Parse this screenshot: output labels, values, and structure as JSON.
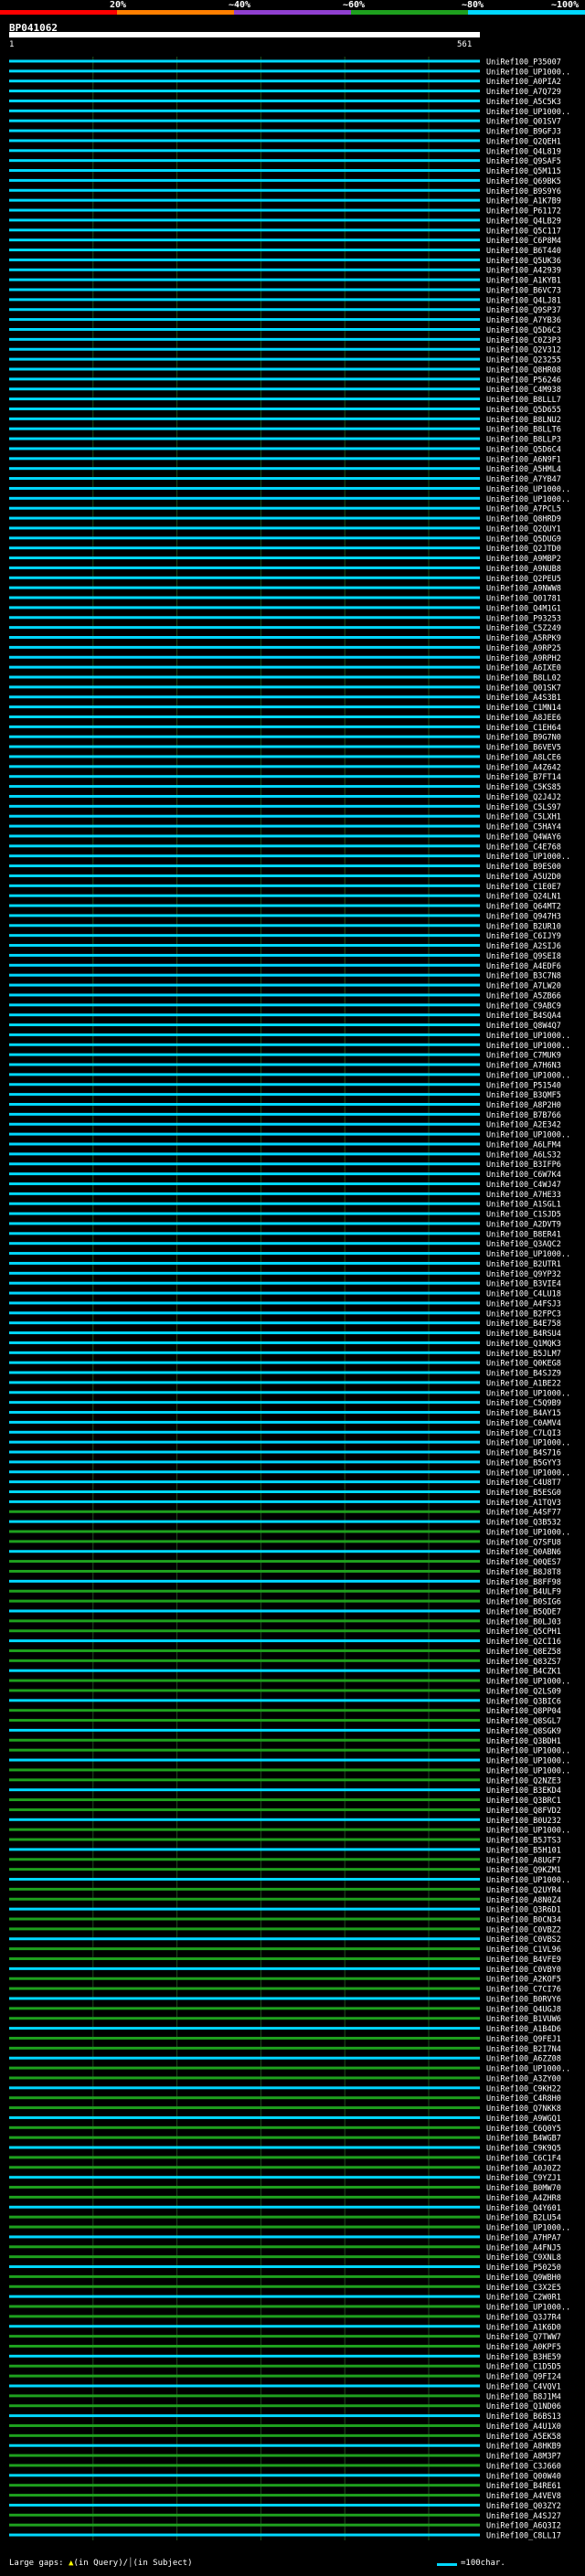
{
  "header": {
    "pct_labels": [
      "20%",
      "~40%",
      "~60%",
      "~80%",
      "~100%"
    ],
    "pct_colors": [
      "#ff0000",
      "#ff7f00",
      "#8f3fcf",
      "#1ea01e",
      "#00d8ff"
    ],
    "query_id": "BP041062",
    "ruler_start": "1",
    "ruler_end": "561"
  },
  "footer": {
    "gaps_label": "Large gaps: ",
    "in_query": "(in Query)/",
    "in_subject": "(in Subject)",
    "legend": "=100char."
  },
  "chart_data": {
    "type": "alignment",
    "query_length": 561,
    "hit_prefix": "UniRef100_",
    "hits": [
      {
        "id": "P35007",
        "identity": "~100%"
      },
      {
        "id": "UP1000..",
        "identity": "~100%"
      },
      {
        "id": "A0PIA2",
        "identity": "~100%"
      },
      {
        "id": "A7Q729",
        "identity": "~100%"
      },
      {
        "id": "A5C5K3",
        "identity": "~100%"
      },
      {
        "id": "UP1000..",
        "identity": "~100%"
      },
      {
        "id": "Q01SV7",
        "identity": "~100%"
      },
      {
        "id": "B9GFJ3",
        "identity": "~100%"
      },
      {
        "id": "Q2QEH1",
        "identity": "~100%"
      },
      {
        "id": "Q4L819",
        "identity": "~100%"
      },
      {
        "id": "Q9SAF5",
        "identity": "~100%"
      },
      {
        "id": "Q5M115",
        "identity": "~100%"
      },
      {
        "id": "Q69BK5",
        "identity": "~100%"
      },
      {
        "id": "B9S9Y6",
        "identity": "~100%"
      },
      {
        "id": "A1K7B9",
        "identity": "~100%"
      },
      {
        "id": "P61172",
        "identity": "~100%"
      },
      {
        "id": "Q4LB29",
        "identity": "~100%"
      },
      {
        "id": "Q5C117",
        "identity": "~100%"
      },
      {
        "id": "C6P8M4",
        "identity": "~100%"
      },
      {
        "id": "B6T440",
        "identity": "~100%"
      },
      {
        "id": "Q5UK36",
        "identity": "~100%"
      },
      {
        "id": "A42939",
        "identity": "~100%"
      },
      {
        "id": "A1KYB1",
        "identity": "~100%"
      },
      {
        "id": "B6VC73",
        "identity": "~100%"
      },
      {
        "id": "Q4LJ81",
        "identity": "~100%"
      },
      {
        "id": "Q9SP37",
        "identity": "~100%"
      },
      {
        "id": "A7YB36",
        "identity": "~100%"
      },
      {
        "id": "Q5D6C3",
        "identity": "~100%"
      },
      {
        "id": "C0Z3P3",
        "identity": "~100%"
      },
      {
        "id": "Q2V312",
        "identity": "~100%"
      },
      {
        "id": "Q23255",
        "identity": "~100%"
      },
      {
        "id": "Q8HR08",
        "identity": "~100%"
      },
      {
        "id": "P56246",
        "identity": "~100%"
      },
      {
        "id": "C4M938",
        "identity": "~100%"
      },
      {
        "id": "B8LLL7",
        "identity": "~100%"
      },
      {
        "id": "Q5D655",
        "identity": "~100%"
      },
      {
        "id": "B8LNU2",
        "identity": "~100%"
      },
      {
        "id": "B8LLT6",
        "identity": "~100%"
      },
      {
        "id": "B8LLP3",
        "identity": "~100%"
      },
      {
        "id": "Q5D6C4",
        "identity": "~100%"
      },
      {
        "id": "A6N9F1",
        "identity": "~100%"
      },
      {
        "id": "A5HML4",
        "identity": "~100%"
      },
      {
        "id": "A7YB47",
        "identity": "~100%"
      },
      {
        "id": "UP1000..",
        "identity": "~100%"
      },
      {
        "id": "UP1000..",
        "identity": "~100%"
      },
      {
        "id": "A7PCL5",
        "identity": "~100%"
      },
      {
        "id": "Q8HRD9",
        "identity": "~100%"
      },
      {
        "id": "Q2QUY1",
        "identity": "~100%"
      },
      {
        "id": "Q5DUG9",
        "identity": "~100%"
      },
      {
        "id": "Q2JTD0",
        "identity": "~100%"
      },
      {
        "id": "A9MBP2",
        "identity": "~100%"
      },
      {
        "id": "A9NUB8",
        "identity": "~100%"
      },
      {
        "id": "Q2PEU5",
        "identity": "~100%"
      },
      {
        "id": "A9NWW8",
        "identity": "~100%"
      },
      {
        "id": "Q01781",
        "identity": "~100%"
      },
      {
        "id": "Q4M1G1",
        "identity": "~100%"
      },
      {
        "id": "P93253",
        "identity": "~100%"
      },
      {
        "id": "C5Z249",
        "identity": "~100%"
      },
      {
        "id": "A5RPK9",
        "identity": "~100%"
      },
      {
        "id": "A9RP25",
        "identity": "~100%"
      },
      {
        "id": "A9RPH2",
        "identity": "~100%"
      },
      {
        "id": "A6IXE0",
        "identity": "~100%"
      },
      {
        "id": "B8LL02",
        "identity": "~100%"
      },
      {
        "id": "Q01SK7",
        "identity": "~100%"
      },
      {
        "id": "A4S3B1",
        "identity": "~100%"
      },
      {
        "id": "C1MN14",
        "identity": "~100%"
      },
      {
        "id": "A8JEE6",
        "identity": "~100%"
      },
      {
        "id": "C1EH64",
        "identity": "~100%"
      },
      {
        "id": "B9G7N0",
        "identity": "~100%"
      },
      {
        "id": "B6VEV5",
        "identity": "~100%"
      },
      {
        "id": "A8LCE6",
        "identity": "~100%"
      },
      {
        "id": "A4Z642",
        "identity": "~100%"
      },
      {
        "id": "B7FT14",
        "identity": "~100%"
      },
      {
        "id": "C5KS85",
        "identity": "~100%"
      },
      {
        "id": "Q2J4J2",
        "identity": "~100%"
      },
      {
        "id": "C5LS97",
        "identity": "~100%"
      },
      {
        "id": "C5LXH1",
        "identity": "~100%"
      },
      {
        "id": "C5HAY4",
        "identity": "~100%"
      },
      {
        "id": "Q4WAY6",
        "identity": "~100%"
      },
      {
        "id": "C4E768",
        "identity": "~100%"
      },
      {
        "id": "UP1000..",
        "identity": "~100%"
      },
      {
        "id": "B9ES00",
        "identity": "~100%"
      },
      {
        "id": "A5U2D0",
        "identity": "~100%"
      },
      {
        "id": "C1E0E7",
        "identity": "~100%"
      },
      {
        "id": "Q24LN1",
        "identity": "~100%"
      },
      {
        "id": "Q64MT2",
        "identity": "~100%"
      },
      {
        "id": "Q947H3",
        "identity": "~100%"
      },
      {
        "id": "B2UR10",
        "identity": "~100%"
      },
      {
        "id": "C6IJY9",
        "identity": "~100%"
      },
      {
        "id": "A2SIJ6",
        "identity": "~100%"
      },
      {
        "id": "Q9SEI8",
        "identity": "~100%"
      },
      {
        "id": "A4EDF6",
        "identity": "~100%"
      },
      {
        "id": "B3C7N8",
        "identity": "~100%"
      },
      {
        "id": "A7LW20",
        "identity": "~100%"
      },
      {
        "id": "A5ZB66",
        "identity": "~100%"
      },
      {
        "id": "C9ABC9",
        "identity": "~100%"
      },
      {
        "id": "B4SQA4",
        "identity": "~100%"
      },
      {
        "id": "Q8W4Q7",
        "identity": "~100%"
      },
      {
        "id": "UP1000..",
        "identity": "~100%"
      },
      {
        "id": "UP1000..",
        "identity": "~100%"
      },
      {
        "id": "C7MUK9",
        "identity": "~100%"
      },
      {
        "id": "A7H6N3",
        "identity": "~100%"
      },
      {
        "id": "UP1000..",
        "identity": "~100%"
      },
      {
        "id": "P51540",
        "identity": "~100%"
      },
      {
        "id": "B3QMF5",
        "identity": "~100%"
      },
      {
        "id": "A8P2H0",
        "identity": "~100%"
      },
      {
        "id": "B7B766",
        "identity": "~100%"
      },
      {
        "id": "A2E342",
        "identity": "~100%"
      },
      {
        "id": "UP1000..",
        "identity": "~100%"
      },
      {
        "id": "A6LFM4",
        "identity": "~100%"
      },
      {
        "id": "A6LS32",
        "identity": "~100%"
      },
      {
        "id": "B3IFP6",
        "identity": "~100%"
      },
      {
        "id": "C6W7K4",
        "identity": "~100%"
      },
      {
        "id": "C4WJ47",
        "identity": "~100%"
      },
      {
        "id": "A7HE33",
        "identity": "~100%"
      },
      {
        "id": "A1SGL1",
        "identity": "~100%"
      },
      {
        "id": "C1SJD5",
        "identity": "~100%"
      },
      {
        "id": "A2DVT9",
        "identity": "~100%"
      },
      {
        "id": "B8ER41",
        "identity": "~100%"
      },
      {
        "id": "Q3AQC2",
        "identity": "~100%"
      },
      {
        "id": "UP1000..",
        "identity": "~100%"
      },
      {
        "id": "B2UTR1",
        "identity": "~100%"
      },
      {
        "id": "Q9YP32",
        "identity": "~100%"
      },
      {
        "id": "B3VIE4",
        "identity": "~100%"
      },
      {
        "id": "C4LU18",
        "identity": "~100%"
      },
      {
        "id": "A4FSJ3",
        "identity": "~100%"
      },
      {
        "id": "B2FPC3",
        "identity": "~100%"
      },
      {
        "id": "B4E758",
        "identity": "~100%"
      },
      {
        "id": "B4RSU4",
        "identity": "~100%"
      },
      {
        "id": "Q1MQK3",
        "identity": "~100%"
      },
      {
        "id": "B5JLM7",
        "identity": "~100%"
      },
      {
        "id": "Q0KEG8",
        "identity": "~100%"
      },
      {
        "id": "B4SJZ9",
        "identity": "~100%"
      },
      {
        "id": "A1BE22",
        "identity": "~100%"
      },
      {
        "id": "UP1000..",
        "identity": "~100%"
      },
      {
        "id": "C5Q9B9",
        "identity": "~100%"
      },
      {
        "id": "B4AY15",
        "identity": "~100%"
      },
      {
        "id": "C0AMV4",
        "identity": "~100%"
      },
      {
        "id": "C7LQI3",
        "identity": "~100%"
      },
      {
        "id": "UP1000..",
        "identity": "~100%"
      },
      {
        "id": "B4S716",
        "identity": "~100%"
      },
      {
        "id": "B5GYY3",
        "identity": "~100%"
      },
      {
        "id": "UP1000..",
        "identity": "~100%"
      },
      {
        "id": "C4U8T7",
        "identity": "~100%"
      },
      {
        "id": "B5ESG0",
        "identity": "~100%"
      },
      {
        "id": "A1TQV3",
        "identity": "~100%"
      },
      {
        "id": "A4SF77",
        "identity": "~100%"
      },
      {
        "id": "Q3B532",
        "identity": "~100%"
      },
      {
        "id": "UP1000..",
        "identity": "~100%"
      },
      {
        "id": "Q7SFU8",
        "identity": "~100%"
      },
      {
        "id": "Q0ABN6",
        "identity": "~100%"
      },
      {
        "id": "Q0QES7",
        "identity": "~100%"
      },
      {
        "id": "B8J8T8",
        "identity": "~100%"
      },
      {
        "id": "B8FF98",
        "identity": "~100%"
      },
      {
        "id": "B4ULF9",
        "identity": "~100%"
      },
      {
        "id": "B0SIG6",
        "identity": "~100%"
      },
      {
        "id": "B5QDE7",
        "identity": "~100%"
      },
      {
        "id": "B0LJ03",
        "identity": "~100%"
      },
      {
        "id": "Q5CPH1",
        "identity": "~100%"
      },
      {
        "id": "Q2CI16",
        "identity": "~100%"
      },
      {
        "id": "Q8EZ58",
        "identity": "~100%"
      },
      {
        "id": "Q83ZS7",
        "identity": "~100%"
      },
      {
        "id": "B4CZK1",
        "identity": "~100%"
      },
      {
        "id": "UP1000..",
        "identity": "~100%"
      },
      {
        "id": "Q2LS09",
        "identity": "~100%"
      },
      {
        "id": "Q3BIC6",
        "identity": "~100%"
      },
      {
        "id": "Q8PP04",
        "identity": "~100%"
      },
      {
        "id": "Q8SGL7",
        "identity": "~100%"
      },
      {
        "id": "Q8SGK9",
        "identity": "~100%"
      },
      {
        "id": "Q3BDH1",
        "identity": "~100%"
      },
      {
        "id": "UP1000..",
        "identity": "~100%"
      },
      {
        "id": "UP1000..",
        "identity": "~100%"
      },
      {
        "id": "UP1000..",
        "identity": "~100%"
      },
      {
        "id": "Q2NZE3",
        "identity": "~100%"
      },
      {
        "id": "B3EKD4",
        "identity": "~100%"
      },
      {
        "id": "Q3BRC1",
        "identity": "~100%"
      },
      {
        "id": "Q8FVD2",
        "identity": "~100%"
      },
      {
        "id": "B0U232",
        "identity": "~100%"
      },
      {
        "id": "UP1000..",
        "identity": "~100%"
      },
      {
        "id": "B5JTS3",
        "identity": "~100%"
      },
      {
        "id": "B5H101",
        "identity": "~100%"
      },
      {
        "id": "A8UGF7",
        "identity": "~100%"
      },
      {
        "id": "Q9KZM1",
        "identity": "~100%"
      },
      {
        "id": "UP1000..",
        "identity": "~100%"
      },
      {
        "id": "Q2UYR4",
        "identity": "~100%"
      },
      {
        "id": "A8N0Z4",
        "identity": "~100%"
      },
      {
        "id": "Q3R6D1",
        "identity": "~100%"
      },
      {
        "id": "B0CN34",
        "identity": "~100%"
      },
      {
        "id": "C0VBZ2",
        "identity": "~100%"
      },
      {
        "id": "C0VBS2",
        "identity": "~100%"
      },
      {
        "id": "C1VL96",
        "identity": "~100%"
      },
      {
        "id": "B4VFE9",
        "identity": "~100%"
      },
      {
        "id": "C0VBY0",
        "identity": "~100%"
      },
      {
        "id": "A2KOF5",
        "identity": "~100%"
      },
      {
        "id": "C7CI76",
        "identity": "~100%"
      },
      {
        "id": "B0RVY6",
        "identity": "~100%"
      },
      {
        "id": "Q4UGJ8",
        "identity": "~100%"
      },
      {
        "id": "B1VUW6",
        "identity": "~100%"
      },
      {
        "id": "A1B4D6",
        "identity": "~100%"
      },
      {
        "id": "Q9FEJ1",
        "identity": "~100%"
      },
      {
        "id": "B2I7N4",
        "identity": "~100%"
      },
      {
        "id": "A6ZZ08",
        "identity": "~100%"
      },
      {
        "id": "UP1000..",
        "identity": "~100%"
      },
      {
        "id": "A3ZY00",
        "identity": "~100%"
      },
      {
        "id": "C9KH22",
        "identity": "~100%"
      },
      {
        "id": "C4R8H0",
        "identity": "~100%"
      },
      {
        "id": "Q7NKK8",
        "identity": "~100%"
      },
      {
        "id": "A9WGQ1",
        "identity": "~100%"
      },
      {
        "id": "C6Q0Y5",
        "identity": "~100%"
      },
      {
        "id": "B4WGB7",
        "identity": "~100%"
      },
      {
        "id": "C9K9Q5",
        "identity": "~100%"
      },
      {
        "id": "C6C1F4",
        "identity": "~100%"
      },
      {
        "id": "A0J0Z2",
        "identity": "~100%"
      },
      {
        "id": "C9YZJ1",
        "identity": "~100%"
      },
      {
        "id": "B0MW70",
        "identity": "~100%"
      },
      {
        "id": "A4ZHR8",
        "identity": "~100%"
      },
      {
        "id": "Q4Y601",
        "identity": "~100%"
      },
      {
        "id": "B2LU54",
        "identity": "~100%"
      },
      {
        "id": "UP1000..",
        "identity": "~100%"
      },
      {
        "id": "A7HPA7",
        "identity": "~100%"
      },
      {
        "id": "A4FNJ5",
        "identity": "~100%"
      },
      {
        "id": "C9XNL8",
        "identity": "~100%"
      },
      {
        "id": "P50250",
        "identity": "~100%"
      },
      {
        "id": "Q9WBH0",
        "identity": "~100%"
      },
      {
        "id": "C3X2E5",
        "identity": "~100%"
      },
      {
        "id": "C2W0R1",
        "identity": "~100%"
      },
      {
        "id": "UP1000..",
        "identity": "~100%"
      },
      {
        "id": "Q3J7R4",
        "identity": "~100%"
      },
      {
        "id": "A1K6D0",
        "identity": "~100%"
      },
      {
        "id": "Q7TWW7",
        "identity": "~100%"
      },
      {
        "id": "A0KPF5",
        "identity": "~100%"
      },
      {
        "id": "B3HE59",
        "identity": "~100%"
      },
      {
        "id": "C1D5D5",
        "identity": "~100%"
      },
      {
        "id": "Q9FI24",
        "identity": "~100%"
      },
      {
        "id": "C4VQV1",
        "identity": "~100%"
      },
      {
        "id": "B8J1M4",
        "identity": "~100%"
      },
      {
        "id": "Q1ND06",
        "identity": "~100%"
      },
      {
        "id": "B6BS13",
        "identity": "~100%"
      },
      {
        "id": "A4U1X0",
        "identity": "~100%"
      },
      {
        "id": "A5EK58",
        "identity": "~100%"
      },
      {
        "id": "A8HKB9",
        "identity": "~100%"
      },
      {
        "id": "A8M3P7",
        "identity": "~100%"
      },
      {
        "id": "C3J660",
        "identity": "~100%"
      },
      {
        "id": "Q00W40",
        "identity": "~100%"
      },
      {
        "id": "B4RE61",
        "identity": "~100%"
      },
      {
        "id": "A4VEV8",
        "identity": "~100%"
      },
      {
        "id": "Q03ZY2",
        "identity": "~100%"
      },
      {
        "id": "A4SJ27",
        "identity": "~100%"
      },
      {
        "id": "A6Q3I2",
        "identity": "~100%"
      },
      {
        "id": "C8LL17",
        "identity": "~100%"
      }
    ]
  }
}
